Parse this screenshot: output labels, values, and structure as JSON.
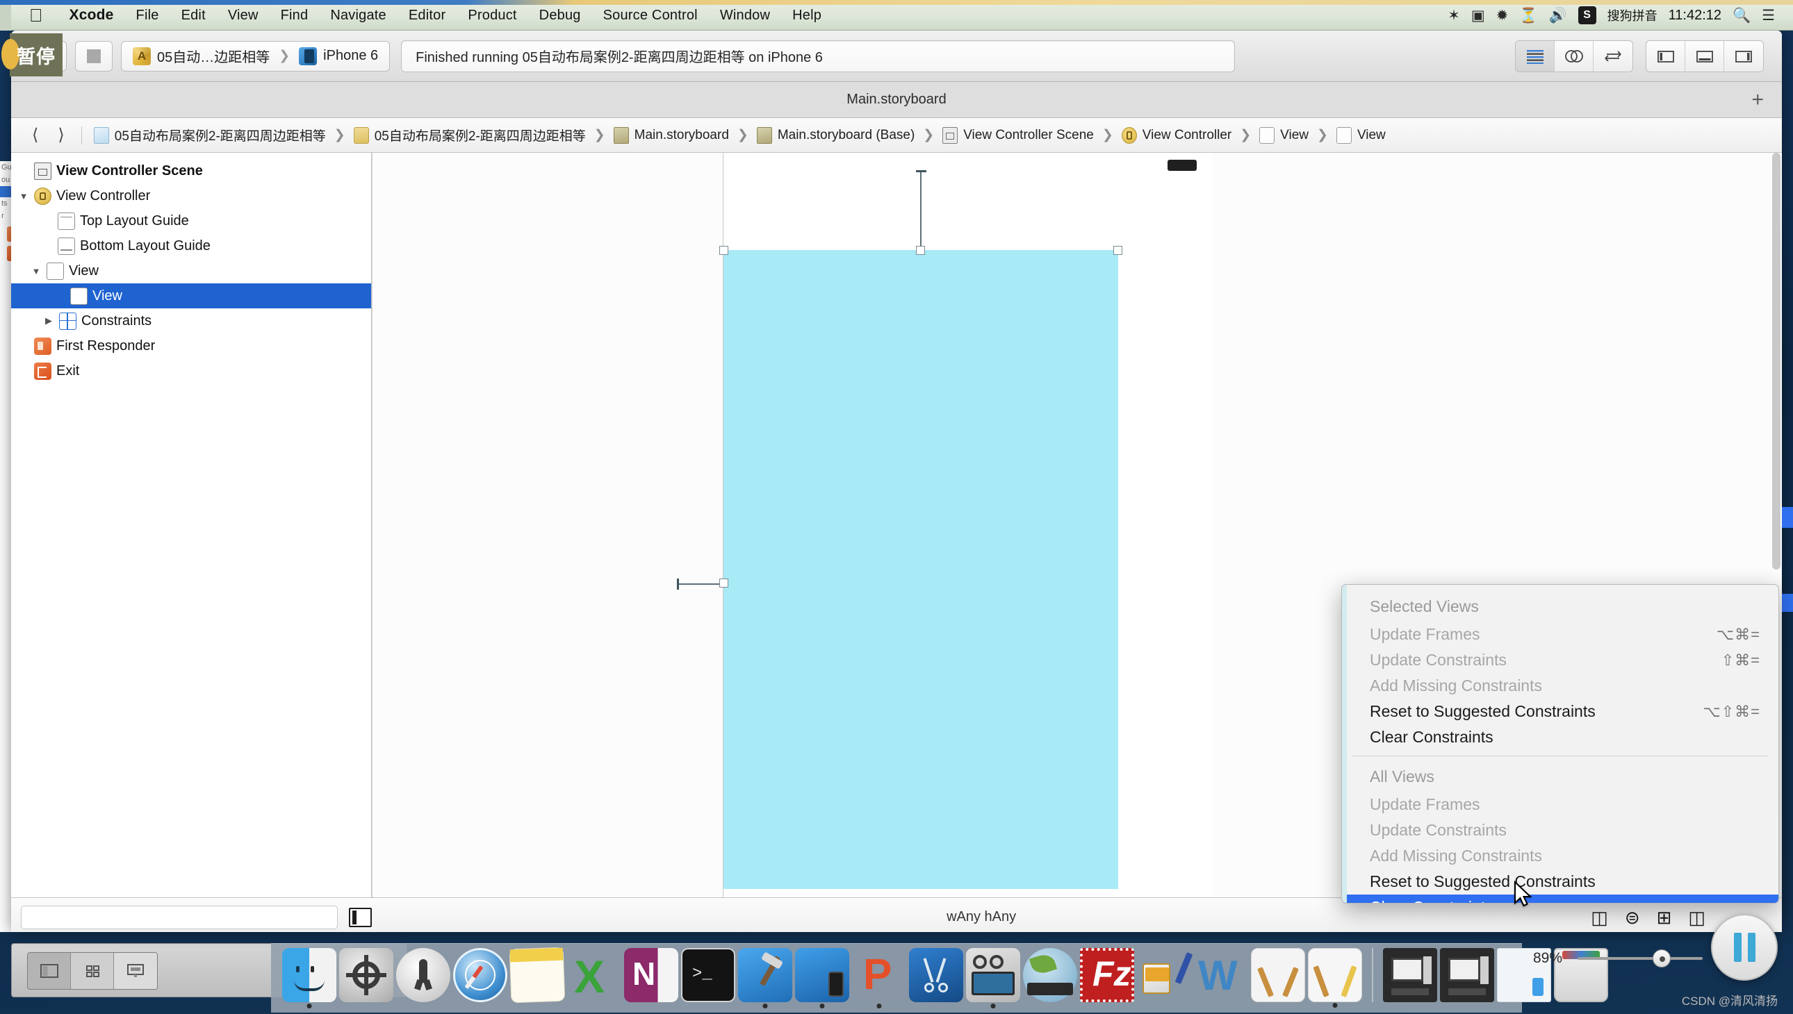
{
  "menubar": {
    "apple_icon": "apple-icon",
    "items": [
      "Xcode",
      "File",
      "Edit",
      "View",
      "Find",
      "Navigate",
      "Editor",
      "Product",
      "Debug",
      "Source Control",
      "Window",
      "Help"
    ],
    "app_name": "Xcode",
    "status_icons": [
      "bluetooth-icon",
      "screen-record-icon",
      "airplay-icon",
      "time-machine-icon",
      "volume-icon"
    ],
    "ime_badge": "S",
    "ime_label": "搜狗拼音",
    "clock": "11:42:12",
    "search_icon": "search-icon",
    "notifications_icon": "notification-center-icon"
  },
  "toolbar": {
    "pause_overlay_label": "暂停",
    "run_icon": "run-play-icon",
    "stop_icon": "stop-square-icon",
    "scheme_name": "05自动…边距相等",
    "scheme_separator": "❯",
    "destination": "iPhone 6",
    "status_text": "Finished running 05自动布局案例2-距离四周边距相等 on iPhone 6",
    "editor_buttons": [
      "standard-editor-icon",
      "assistant-editor-icon",
      "version-editor-icon"
    ],
    "panel_buttons": [
      "toggle-navigator-icon",
      "toggle-debug-area-icon",
      "toggle-utilities-icon"
    ]
  },
  "tabstrip": {
    "title": "Main.storyboard",
    "add_tab_icon": "plus-icon"
  },
  "jumpbar": {
    "back_icon": "chevron-left-icon",
    "forward_icon": "chevron-right-icon",
    "separator": "❯",
    "crumbs": [
      {
        "label": "05自动布局案例2-距离四周边距相等",
        "icon": "project-file-icon"
      },
      {
        "label": "05自动布局案例2-距离四周边距相等",
        "icon": "folder-icon"
      },
      {
        "label": "Main.storyboard",
        "icon": "storyboard-file-icon"
      },
      {
        "label": "Main.storyboard (Base)",
        "icon": "storyboard-file-icon"
      },
      {
        "label": "View Controller Scene",
        "icon": "scene-icon"
      },
      {
        "label": "View Controller",
        "icon": "view-controller-icon"
      },
      {
        "label": "View",
        "icon": "view-icon"
      },
      {
        "label": "View",
        "icon": "view-icon"
      }
    ]
  },
  "outline": {
    "header": "View Controller Scene",
    "header_icon": "scene-icon",
    "rows": [
      {
        "label": "View Controller",
        "icon": "view-controller-icon",
        "indent": 0,
        "triangle": "down",
        "selected": false
      },
      {
        "label": "Top Layout Guide",
        "icon": "top-layout-guide-icon",
        "indent": 1,
        "triangle": "none",
        "selected": false
      },
      {
        "label": "Bottom Layout Guide",
        "icon": "bottom-layout-guide-icon",
        "indent": 1,
        "triangle": "none",
        "selected": false
      },
      {
        "label": "View",
        "icon": "view-icon",
        "indent": 1,
        "triangle": "down",
        "selected": false
      },
      {
        "label": "View",
        "icon": "view-icon",
        "indent": 2,
        "triangle": "none",
        "selected": true
      },
      {
        "label": "Constraints",
        "icon": "constraints-icon",
        "indent": 2,
        "triangle": "right",
        "selected": false
      },
      {
        "label": "First Responder",
        "icon": "first-responder-icon",
        "indent": 0,
        "triangle": "none",
        "selected": false
      },
      {
        "label": "Exit",
        "icon": "exit-icon",
        "indent": 0,
        "triangle": "none",
        "selected": false
      }
    ]
  },
  "canvas": {
    "view_fill_color": "#a8eaf5",
    "status_bar_icon": "device-status-bar-icon",
    "entry_arrow_icon": "initial-view-controller-arrow-icon",
    "selection_handles": 4,
    "constraint_top_icon": "top-spacing-constraint",
    "constraint_left_icon": "leading-spacing-constraint"
  },
  "editor_footer": {
    "filter_placeholder": "",
    "filter_value": "",
    "toggle_outline_icon": "toggle-document-outline-icon",
    "size_class": {
      "width": "wAny",
      "height": "hAny",
      "w_prefix": "w",
      "h_prefix": "h",
      "full": "wAny  hAny"
    },
    "autolayout_buttons": [
      "stack-icon",
      "align-icon",
      "pin-icon",
      "resolve-auto-layout-issues-icon"
    ]
  },
  "context_menu": {
    "sections": [
      {
        "title": "Selected Views",
        "items": [
          {
            "label": "Update Frames",
            "shortcut": "⌥⌘=",
            "disabled": true,
            "highlighted": false
          },
          {
            "label": "Update Constraints",
            "shortcut": "⇧⌘=",
            "disabled": true,
            "highlighted": false
          },
          {
            "label": "Add Missing Constraints",
            "shortcut": "",
            "disabled": true,
            "highlighted": false
          },
          {
            "label": "Reset to Suggested Constraints",
            "shortcut": "⌥⇧⌘=",
            "disabled": false,
            "highlighted": false
          },
          {
            "label": "Clear Constraints",
            "shortcut": "",
            "disabled": false,
            "highlighted": false
          }
        ]
      },
      {
        "title": "All Views",
        "items": [
          {
            "label": "Update Frames",
            "shortcut": "",
            "disabled": true,
            "highlighted": false
          },
          {
            "label": "Update Constraints",
            "shortcut": "",
            "disabled": true,
            "highlighted": false
          },
          {
            "label": "Add Missing Constraints",
            "shortcut": "",
            "disabled": true,
            "highlighted": false
          },
          {
            "label": "Reset to Suggested Constraints",
            "shortcut": "",
            "disabled": false,
            "highlighted": false
          },
          {
            "label": "Clear Constraints",
            "shortcut": "",
            "disabled": false,
            "highlighted": true
          }
        ]
      }
    ]
  },
  "dock": {
    "items": [
      {
        "name": "finder",
        "running": true
      },
      {
        "name": "system-preferences",
        "running": false
      },
      {
        "name": "launchpad",
        "running": false
      },
      {
        "name": "safari",
        "running": false
      },
      {
        "name": "notes",
        "running": false
      },
      {
        "name": "excel",
        "running": false
      },
      {
        "name": "onenote",
        "running": false
      },
      {
        "name": "terminal",
        "running": false
      },
      {
        "name": "xcode",
        "running": true
      },
      {
        "name": "interface-builder",
        "running": true
      },
      {
        "name": "keynote",
        "running": true
      },
      {
        "name": "snipaste",
        "running": false
      },
      {
        "name": "screenflow",
        "running": true
      },
      {
        "name": "ftp-client",
        "running": false
      },
      {
        "name": "filezilla",
        "running": false
      },
      {
        "name": "paint-tool",
        "running": false
      },
      {
        "name": "word",
        "running": false
      },
      {
        "name": "preview",
        "running": false
      },
      {
        "name": "sketch-app",
        "running": true
      },
      {
        "name": "remote-desktop-1",
        "running": false
      },
      {
        "name": "remote-desktop-2",
        "running": false
      },
      {
        "name": "stack-window",
        "running": false
      },
      {
        "name": "trash",
        "running": false
      }
    ]
  },
  "zoom_control": {
    "percent": "89%",
    "slider_icon": "zoom-slider"
  },
  "float_pause": {
    "icon": "pause-icon"
  },
  "watermark": {
    "text": "CSDN @清风清扬"
  },
  "background_window": {
    "fragment_texts": [
      "Gu",
      "ou",
      "ts",
      "r"
    ]
  }
}
